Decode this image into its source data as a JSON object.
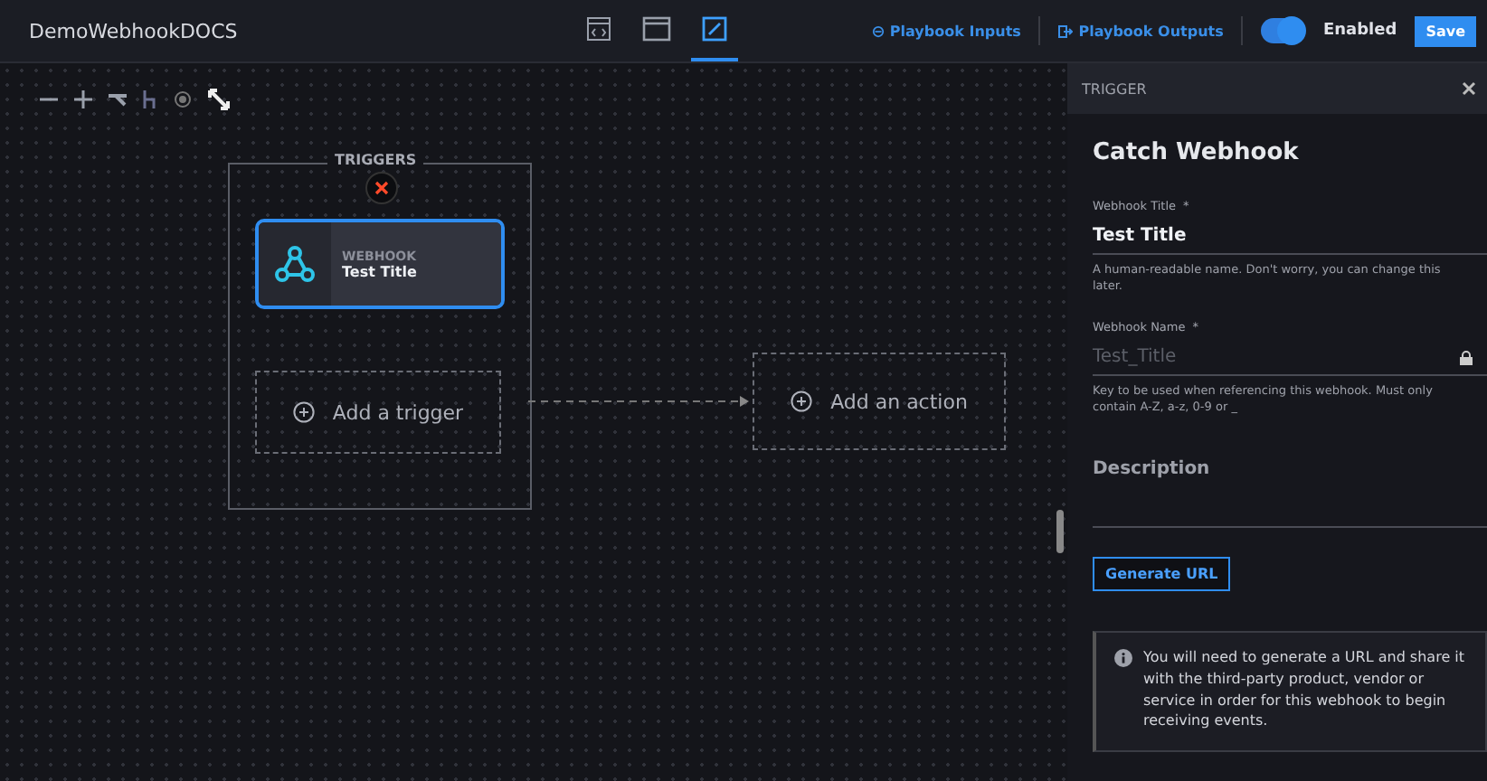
{
  "header": {
    "title": "DemoWebhookDOCS",
    "views": [
      {
        "kind": "code",
        "selected": false
      },
      {
        "kind": "window",
        "selected": false
      },
      {
        "kind": "edit",
        "selected": true
      }
    ],
    "inputs_link": "Playbook Inputs",
    "outputs_link": "Playbook Outputs",
    "toggle": {
      "label": "Enabled",
      "on": true
    },
    "save": "Save"
  },
  "canvas": {
    "group_title": "TRIGGERS",
    "trigger": {
      "type": "WEBHOOK",
      "title": "Test Title",
      "selected": true
    },
    "add_trigger": "Add a trigger",
    "add_action": "Add an action"
  },
  "panel": {
    "header": "TRIGGER",
    "title": "Catch Webhook",
    "fields": [
      {
        "label": "Webhook Title",
        "required_mark": "*",
        "value": "Test Title",
        "locked": false,
        "help": "A human-readable name. Don't worry, you can change this later."
      },
      {
        "label": "Webhook Name",
        "required_mark": "*",
        "placeholder": "Test_Title",
        "locked": true,
        "help": "Key to be used when referencing this webhook. Must only contain A-Z, a-z, 0-9 or _"
      }
    ],
    "description": "Description",
    "generate": "Generate URL",
    "info": "You will need to generate a URL and share it with the third-party product, vendor or service in order for this webhook to begin receiving events."
  }
}
